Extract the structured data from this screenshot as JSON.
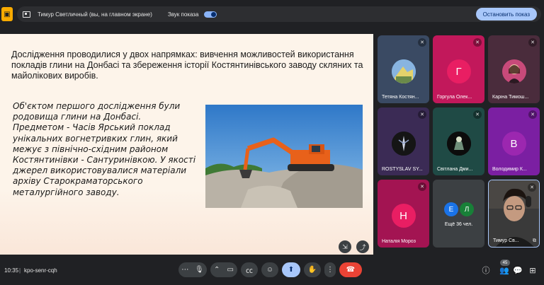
{
  "topbar": {
    "presenter": "Тимур Светличный (вы, на главном экране)",
    "sound_label": "Звук показа",
    "stop_label": "Остановить показ"
  },
  "slide": {
    "title": "Дослідження проводилися у двох напрямках: вивчення можливостей використання покладів глини на Донбасі та збереження історії Костянтинівського заводу скляних та майолікових виробів.",
    "body_lines": [
      "Об'єктом першого дослідження були",
      "родовища глини на Донбасі.",
      "Предметом - Часів Ярський поклад",
      "унікальних вогнетривких глин, який",
      "межує з північно-східним районом",
      "Костянтинівки - Сантуринівкою. У якості",
      "джерел використовувалися матеріали",
      "архіву Старокраматорського",
      "металургійного заводу."
    ]
  },
  "participants": [
    {
      "name": "Тетяна Костян...",
      "initial": "",
      "bg": "#3a4a63"
    },
    {
      "name": "Горгула Олек...",
      "initial": "Г",
      "bg": "#c2185b"
    },
    {
      "name": "Каріна Тимош...",
      "initial": "",
      "bg": "#4a2c3c"
    },
    {
      "name": "ROSTYSLAV SY...",
      "initial": "",
      "bg": "#3b2b55"
    },
    {
      "name": "Світлана Дми...",
      "initial": "",
      "bg": "#1f4a45"
    },
    {
      "name": "Володимир К...",
      "initial": "В",
      "bg": "#7b1fa2"
    },
    {
      "name": "Наталія Мороз",
      "initial": "Н",
      "bg": "#d81b60"
    },
    {
      "name": "Тимур Св...",
      "initial": "",
      "bg": "#2a2a2a"
    }
  ],
  "more": {
    "label": "Ещё 36 чел.",
    "initials": [
      "Е",
      "Л"
    ]
  },
  "bottom": {
    "time": "10:35",
    "separator": "|",
    "code": "kpo-senr-cqh",
    "participant_count": "45"
  },
  "colors": {
    "accent": "#a8c7fa",
    "end_call": "#ea4335",
    "present_badge": "#f9ab00"
  }
}
